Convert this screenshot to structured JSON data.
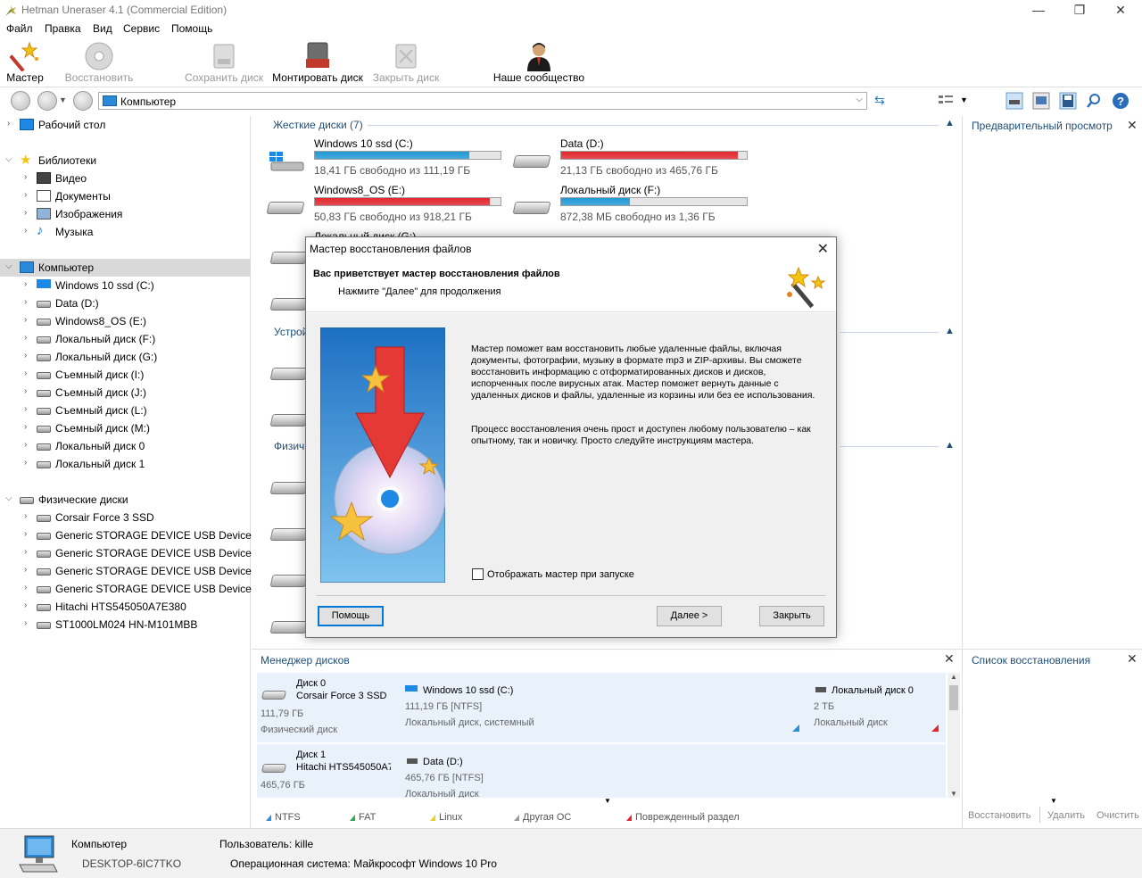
{
  "window": {
    "title": "Hetman Uneraser 4.1 (Commercial Edition)",
    "minimize": "—",
    "restore": "❐",
    "close": "✕"
  },
  "menu": [
    "Файл",
    "Правка",
    "Вид",
    "Сервис",
    "Помощь"
  ],
  "toolbar": {
    "wizard": "Мастер",
    "restore": "Восстановить",
    "save_disk": "Сохранить диск",
    "mount_disk": "Монтировать диск",
    "close_disk": "Закрыть диск",
    "community": "Наше сообщество"
  },
  "address": {
    "value": "Компьютер"
  },
  "tree": {
    "desktop": "Рабочий стол",
    "libraries": "Библиотеки",
    "video": "Видео",
    "documents": "Документы",
    "images": "Изображения",
    "music": "Музыка",
    "computer": "Компьютер",
    "drives": [
      "Windows 10 ssd (C:)",
      "Data (D:)",
      "Windows8_OS (E:)",
      "Локальный диск (F:)",
      "Локальный диск (G:)",
      "Съемный диск (I:)",
      "Съемный диск (J:)",
      "Съемный диск (L:)",
      "Съемный диск (M:)",
      "Локальный диск 0",
      "Локальный диск 1"
    ],
    "physical": "Физические диски",
    "physical_disks": [
      "Corsair Force 3 SSD",
      "Generic STORAGE DEVICE USB Device",
      "Generic STORAGE DEVICE USB Device",
      "Generic STORAGE DEVICE USB Device",
      "Generic STORAGE DEVICE USB Device",
      "Hitachi HTS545050A7E380",
      "ST1000LM024 HN-M101MBB"
    ]
  },
  "main": {
    "hard_disks_header": "Жесткие диски (7)",
    "devices_header": "Устрой",
    "physical_header": "Физич",
    "drives": [
      {
        "name": "Windows 10 ssd (C:)",
        "free": "18,41 ГБ свободно из 111,19 ГБ",
        "used_fraction": 0.83,
        "color": "#1f9ad6"
      },
      {
        "name": "Data (D:)",
        "free": "21,13 ГБ свободно из 465,76 ГБ",
        "used_fraction": 0.95,
        "color": "#e5262e"
      },
      {
        "name": "Windows8_OS (E:)",
        "free": "50,83 ГБ свободно из 918,21 ГБ",
        "used_fraction": 0.94,
        "color": "#e5262e"
      },
      {
        "name": "Локальный диск (F:)",
        "free": "872,38 МБ свободно из 1,36 ГБ",
        "used_fraction": 0.37,
        "color": "#1f9ad6"
      }
    ],
    "partial_drive": "Локальный диск (G:)"
  },
  "preview": {
    "title": "Предварительный просмотр"
  },
  "disk_manager": {
    "title": "Менеджер дисков",
    "rows": [
      {
        "disk": "Диск 0",
        "model": "Corsair Force 3 SSD",
        "size": "111,79 ГБ",
        "kind": "Физический диск",
        "part1_name": "Windows 10 ssd (C:)",
        "part1_size": "111,19 ГБ [NTFS]",
        "part1_desc": "Локальный диск, системный",
        "part2_name": "Локальный диск 0",
        "part2_size": "2 ТБ",
        "part2_desc": "Локальный диск"
      },
      {
        "disk": "Диск 1",
        "model": "Hitachi HTS545050A7",
        "size": "465,76 ГБ",
        "part1_name": "Data (D:)",
        "part1_size": "465,76 ГБ [NTFS]",
        "part1_desc": "Локальный диск"
      }
    ],
    "legend": [
      {
        "label": "NTFS",
        "color": "#2b8fd6"
      },
      {
        "label": "FAT",
        "color": "#2fa84f"
      },
      {
        "label": "Linux",
        "color": "#e8d21d"
      },
      {
        "label": "Другая ОС",
        "color": "#9a9a9a"
      },
      {
        "label": "Поврежденный раздел",
        "color": "#e5262e"
      }
    ]
  },
  "recovery_list": {
    "title": "Список восстановления",
    "restore": "Восстановить",
    "delete": "Удалить",
    "clear": "Очистить"
  },
  "status": {
    "computer": "Компьютер",
    "host": "DESKTOP-6IC7TKO",
    "user_label": "Пользователь: kille",
    "os_label": "Операционная система: Майкрософт Windows 10 Pro"
  },
  "dialog": {
    "title": "Мастер восстановления файлов",
    "heading": "Вас приветствует мастер восстановления файлов",
    "subheading": "Нажмите \"Далее\" для продолжения",
    "para1": "Мастер поможет вам восстановить любые удаленные файлы, включая документы, фотографии, музыку в формате mp3 и ZIP-архивы. Вы сможете восстановить информацию с отформатированных дисков и дисков, испорченных после вирусных атак. Мастер поможет вернуть данные с удаленных дисков и файлы, удаленные из корзины или без ее использования.",
    "para2": "Процесс восстановления очень прост и доступен любому пользователю – как опытному, так и новичку. Просто следуйте инструкциям мастера.",
    "checkbox": "Отображать мастер при запуске",
    "help": "Помощь",
    "next": "Далее >",
    "close": "Закрыть",
    "close_x": "✕"
  }
}
